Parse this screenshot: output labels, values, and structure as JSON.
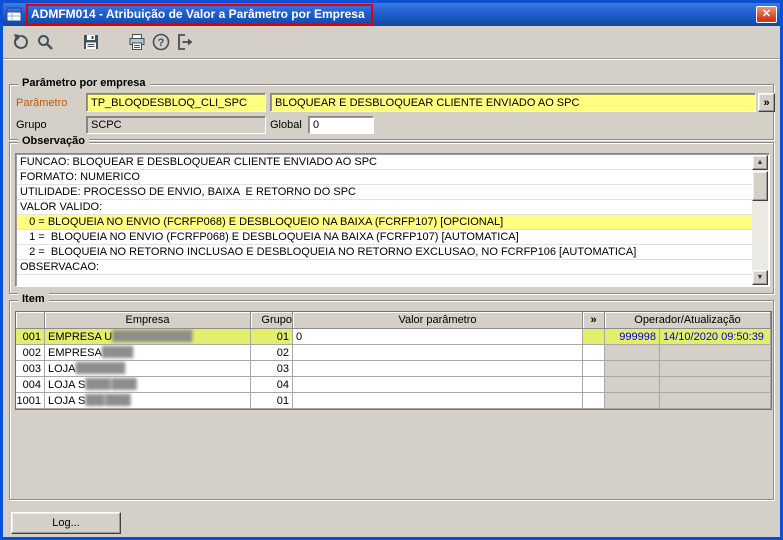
{
  "colors": {
    "window_border_blue": "#0b4fd7",
    "titlebar_blue": "#1f5ecf",
    "dialog_gray": "#d4d0c8",
    "field_yellow": "#ffff80",
    "row_highlight_yellow": "#e3ee6e",
    "value_blue": "#0000cc",
    "annotation_red": "#e00000",
    "param_label_orange": "#c25a00"
  },
  "window": {
    "title": "ADMFM014 - Atribuição de Valor a Parâmetro por Empresa",
    "close_glyph": "✕"
  },
  "toolbar": {
    "icons": [
      "undo-icon",
      "search-icon",
      "save-icon",
      "print-icon",
      "help-icon",
      "exit-icon"
    ]
  },
  "param_group": {
    "title": "Parâmetro por empresa",
    "param_label": "Parâmetro",
    "param_value": "TP_BLOQDESBLOQ_CLI_SPC",
    "param_description": "BLOQUEAR E DESBLOQUEAR CLIENTE ENVIADO AO SPC",
    "expand_button": "»",
    "grupo_label": "Grupo",
    "grupo_value": "SCPC",
    "global_label": "Global",
    "global_value": "0"
  },
  "observacao": {
    "title": "Observação",
    "lines": [
      {
        "text": "FUNCAO: BLOQUEAR E DESBLOQUEAR CLIENTE ENVIADO AO SPC",
        "highlight": false
      },
      {
        "text": "FORMATO: NUMERICO",
        "highlight": false
      },
      {
        "text": "UTILIDADE: PROCESSO DE ENVIO, BAIXA  E RETORNO DO SPC",
        "highlight": false
      },
      {
        "text": "VALOR VALIDO:",
        "highlight": false
      },
      {
        "text": "   0 = BLOQUEIA NO ENVIO (FCRFP068) E DESBLOQUEIO NA BAIXA (FCRFP107) [OPCIONAL]",
        "highlight": true
      },
      {
        "text": "   1 =  BLOQUEIA NO ENVIO (FCRFP068) E DESBLOQUEIA NA BAIXA (FCRFP107) [AUTOMATICA]",
        "highlight": false
      },
      {
        "text": "   2 =  BLOQUEIA NO RETORNO INCLUSAO E DESBLOQUEIA NO RETORNO EXCLUSAO, NO FCRFP106 [AUTOMATICA]",
        "highlight": false
      },
      {
        "text": "OBSERVACAO:",
        "highlight": false
      }
    ],
    "scroll_up_glyph": "▲",
    "scroll_down_glyph": "▼"
  },
  "item": {
    "title": "Item",
    "columns": [
      "",
      "Empresa",
      "Grupo",
      "Valor parâmetro",
      "»",
      "Operador/Atualização"
    ],
    "rows": [
      {
        "num": "001",
        "empresa_visible": "EMPRESA U",
        "empresa_redacted": "█████████████",
        "grupo": "01",
        "valor": "0",
        "operador": "999998",
        "atualizacao": "14/10/2020 09:50:39",
        "selected": true
      },
      {
        "num": "002",
        "empresa_visible": "EMPRESA ",
        "empresa_redacted": "█████",
        "grupo": "02",
        "valor": "",
        "operador": "",
        "atualizacao": "",
        "selected": false
      },
      {
        "num": "003",
        "empresa_visible": "LOJA ",
        "empresa_redacted": "████████",
        "grupo": "03",
        "valor": "",
        "operador": "",
        "atualizacao": "",
        "selected": false
      },
      {
        "num": "004",
        "empresa_visible": "LOJA S",
        "empresa_redacted": "████ ████",
        "grupo": "04",
        "valor": "",
        "operador": "",
        "atualizacao": "",
        "selected": false
      },
      {
        "num": "1001",
        "empresa_visible": "LOJA S",
        "empresa_redacted": "███ ████",
        "grupo": "01",
        "valor": "",
        "operador": "",
        "atualizacao": "",
        "selected": false
      }
    ]
  },
  "footer": {
    "log_button": "Log..."
  }
}
